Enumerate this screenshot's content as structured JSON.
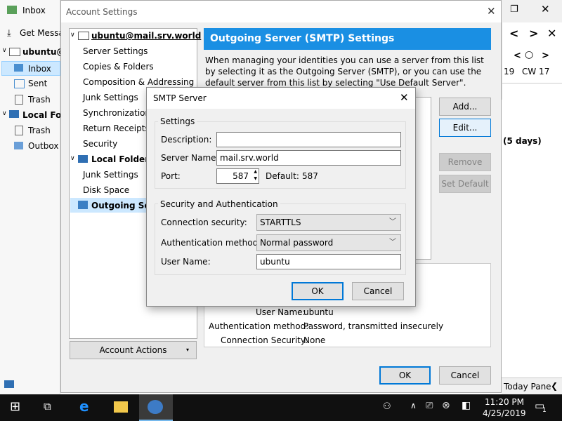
{
  "background_app": {
    "folders": [
      {
        "label": "Inbox"
      },
      {
        "label": "Get Messag"
      },
      {
        "label": "ubuntu@"
      },
      {
        "label": "Inbox"
      },
      {
        "label": "Sent"
      },
      {
        "label": "Trash"
      },
      {
        "label": "Local Fold"
      },
      {
        "label": "Trash"
      },
      {
        "label": "Outbox"
      }
    ],
    "right_panel": {
      "date_a": "19",
      "week": "CW 17",
      "days_text": "(5 days)",
      "today_pane": "Today Pane"
    }
  },
  "account_settings": {
    "title": "Account Settings",
    "tree": [
      {
        "label": "ubuntu@mail.srv.world"
      },
      {
        "label": "Server Settings"
      },
      {
        "label": "Copies & Folders"
      },
      {
        "label": "Composition & Addressing"
      },
      {
        "label": "Junk Settings"
      },
      {
        "label": "Synchronization &"
      },
      {
        "label": "Return Receipts"
      },
      {
        "label": "Security"
      },
      {
        "label": "Local Folders"
      },
      {
        "label": "Junk Settings"
      },
      {
        "label": "Disk Space"
      },
      {
        "label": "Outgoing Serv"
      }
    ],
    "account_actions": "Account Actions",
    "header": "Outgoing Server (SMTP) Settings",
    "description": "When managing your identities you can use a server from this list by selecting it as the Outgoing Server (SMTP), or you can use the default server from this list by selecting \"Use Default Server\".",
    "buttons": {
      "add": "Add...",
      "edit": "Edit...",
      "remove": "Remove",
      "set_default": "Set Default"
    },
    "details": {
      "user_name_label": "User Name:",
      "user_name_value": "ubuntu",
      "auth_label": "Authentication method:",
      "auth_value": "Password, transmitted insecurely",
      "conn_label": "Connection Security:",
      "conn_value": "None"
    },
    "ok": "OK",
    "cancel": "Cancel"
  },
  "smtp_dialog": {
    "title": "SMTP Server",
    "settings_group": "Settings",
    "description_label": "Description:",
    "description_value": "",
    "server_name_label": "Server Name:",
    "server_name_value": "mail.srv.world",
    "port_label": "Port:",
    "port_value": "587",
    "default_label": "Default:",
    "default_value": "587",
    "security_group": "Security and Authentication",
    "conn_security_label": "Connection security:",
    "conn_security_value": "STARTTLS",
    "auth_method_label": "Authentication method:",
    "auth_method_value": "Normal password",
    "user_name_label": "User Name:",
    "user_name_value": "ubuntu",
    "ok": "OK",
    "cancel": "Cancel"
  },
  "taskbar": {
    "time": "11:20 PM",
    "date": "4/25/2019",
    "notification_count": "1"
  }
}
